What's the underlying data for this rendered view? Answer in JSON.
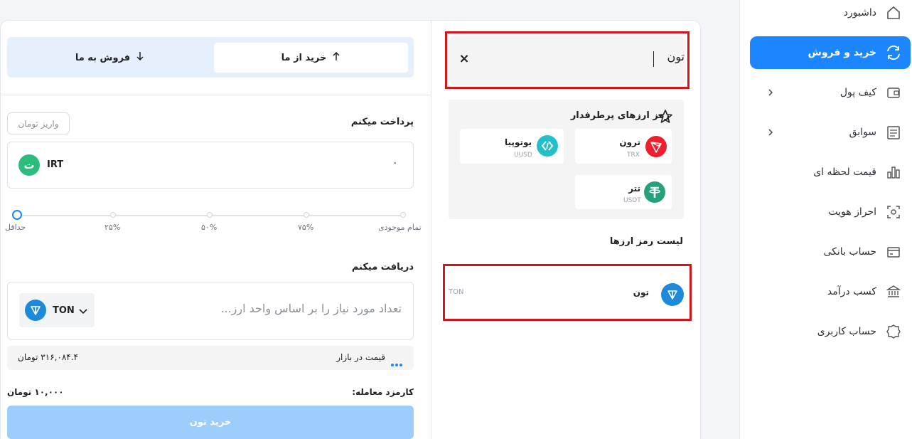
{
  "sidebar": {
    "items": [
      {
        "label": "داشبورد",
        "icon": "home-icon",
        "active": false
      },
      {
        "label": "خرید و فروش",
        "icon": "exchange-icon",
        "active": true
      },
      {
        "label": "کیف پول",
        "icon": "wallet-icon",
        "active": false,
        "expandable": true
      },
      {
        "label": "سوابق",
        "icon": "history-icon",
        "active": false,
        "expandable": true
      },
      {
        "label": "قیمت لحظه ای",
        "icon": "chart-icon",
        "active": false
      },
      {
        "label": "احراز هویت",
        "icon": "identity-scan-icon",
        "active": false
      },
      {
        "label": "حساب بانکی",
        "icon": "bank-card-icon",
        "active": false
      },
      {
        "label": "کسب درآمد",
        "icon": "bank-building-icon",
        "active": false
      },
      {
        "label": "حساب کاربری",
        "icon": "user-badge-icon",
        "active": false
      }
    ]
  },
  "search": {
    "value": "تون",
    "clear_icon": "close-icon"
  },
  "popular": {
    "title": "رمز ارزهای پرطرفدار",
    "coins": [
      {
        "name": "ترون",
        "symbol": "TRX",
        "color": "#ef1f2d"
      },
      {
        "name": "یوتوپیا",
        "symbol": "UUSD",
        "color": "#23c0c9"
      },
      {
        "name": "تتر",
        "symbol": "USDT",
        "color": "#26a17b"
      }
    ]
  },
  "list": {
    "title": "لیست رمز ارزها",
    "rows": [
      {
        "name": "تون",
        "symbol": "TON",
        "color": "#1c8adb"
      }
    ]
  },
  "trade": {
    "tabs": {
      "buy": "خرید از ما",
      "sell": "فروش به ما"
    },
    "pay_label": "پرداخت میکنم",
    "deposit_button": "واریز تومان",
    "pay_amount": "۰",
    "pay_currency": "IRT",
    "pay_currency_glyph": "ت",
    "slider_labels": [
      "تمام موجودی",
      "۷۵%",
      "۵۰%",
      "۲۵%",
      "حداقل"
    ],
    "receive_label": "دریافت میکنم",
    "receive_placeholder": "تعداد مورد نیاز را بر اساس واحد ارز...",
    "receive_currency": "TON",
    "market_price_label": "قیمت در بازار",
    "market_price_value": "۳۱۶,۰۸۴.۴ تومان",
    "fee_label": "کارمزد معامله:",
    "fee_value": "۱۰,۰۰۰ تومان",
    "buy_button": "خرید تون"
  },
  "colors": {
    "accent": "#1b86ff",
    "highlight_outline": "#d4151c",
    "buy_button_disabled": "#9ccdfb"
  }
}
